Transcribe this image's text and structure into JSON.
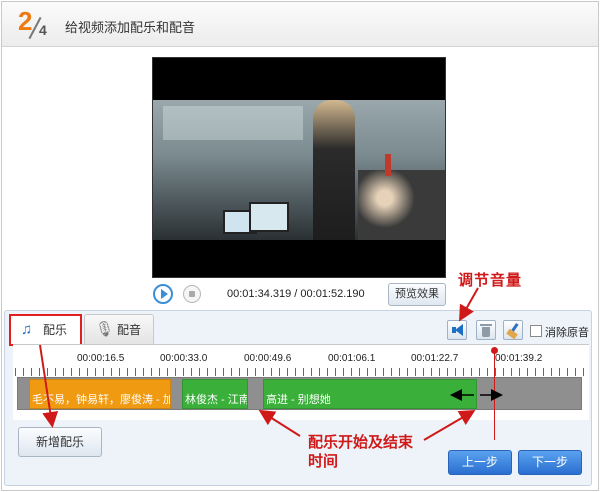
{
  "header": {
    "step_current": "2",
    "step_total": "4",
    "title": "给视频添加配乐和配音"
  },
  "player": {
    "time_display": "00:01:34.319 / 00:01:52.190",
    "preview_label": "预览效果"
  },
  "tabs": [
    {
      "label": "配乐",
      "icon": "music-note-icon"
    },
    {
      "label": "配音",
      "icon": "microphone-icon"
    }
  ],
  "toolbar": {
    "mute_original_label": "消除原音"
  },
  "timeline": {
    "ruler": [
      "00:00:16.5",
      "00:00:33.0",
      "00:00:49.6",
      "00:01:06.1",
      "00:01:22.7",
      "00:01:39.2"
    ],
    "clips": [
      {
        "label": "毛不易，钟易轩，廖俊涛 - 加喂",
        "color": "#f09a12"
      },
      {
        "label": "林俊杰 - 江南",
        "color": "#3ab03a"
      },
      {
        "label": "高进 - 别想她",
        "color": "#3ab03a"
      }
    ]
  },
  "buttons": {
    "add_music": "新增配乐",
    "prev": "上一步",
    "next": "下一步"
  },
  "annotations": {
    "volume": "调节音量",
    "start_end": "配乐开始及结束时间"
  },
  "colors": {
    "accent": "#f07a12",
    "annotation": "#d01a1a",
    "primary_button": "#2a6fd0"
  }
}
